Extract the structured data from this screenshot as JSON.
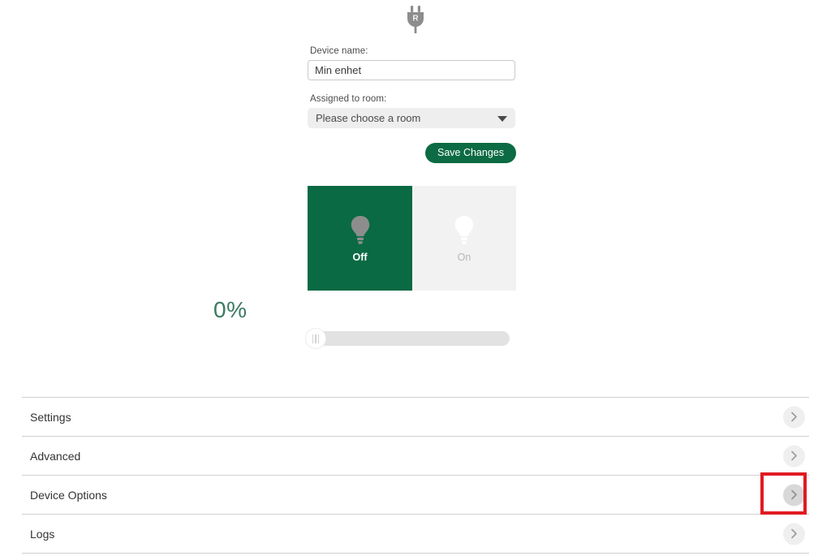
{
  "header": {
    "device_icon": "plug-icon"
  },
  "form": {
    "name_label": "Device name:",
    "name_value": "Min enhet",
    "name_placeholder": "Device name",
    "room_label": "Assigned to room:",
    "room_selected": "Please choose a room",
    "save_label": "Save Changes",
    "save_color": "#0c6b43"
  },
  "power": {
    "off_label": "Off",
    "on_label": "On",
    "active": "Off",
    "off_bg": "#0a6a43",
    "on_bg": "#f2f2f2",
    "off_icon": "lightbulb-icon",
    "on_icon": "lightbulb-icon"
  },
  "dimmer": {
    "percent_text": "0%",
    "percent_value": 0,
    "percent_color": "#3b7a5f",
    "track_color": "#e2e2e2"
  },
  "accordion": {
    "items": [
      {
        "label": "Settings",
        "chevron": "chevron-right-icon",
        "highlighted": false
      },
      {
        "label": "Advanced",
        "chevron": "chevron-right-icon",
        "highlighted": false
      },
      {
        "label": "Device Options",
        "chevron": "chevron-right-icon",
        "highlighted": true
      },
      {
        "label": "Logs",
        "chevron": "chevron-right-icon",
        "highlighted": false
      }
    ]
  },
  "annotation": {
    "highlight_color": "#e01b22",
    "target": "Device Options"
  }
}
